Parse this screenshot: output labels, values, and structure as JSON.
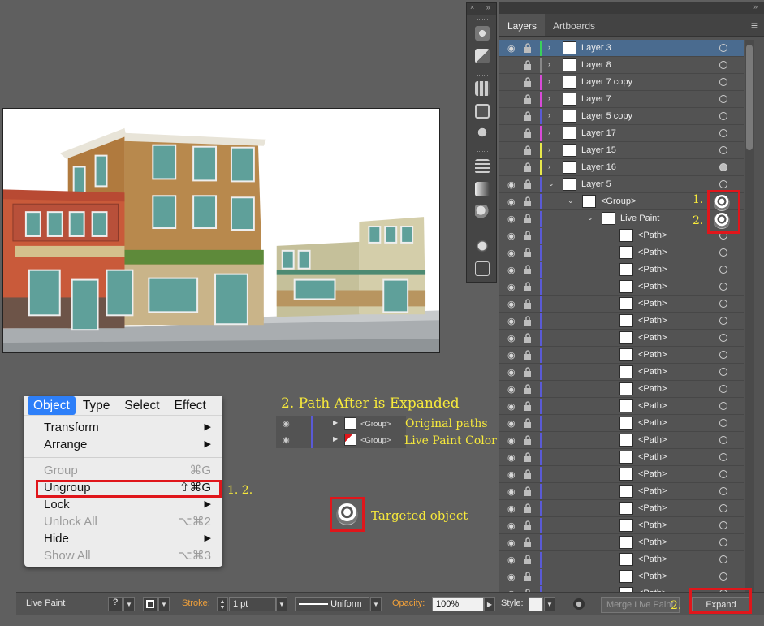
{
  "menu": {
    "bar": [
      "Object",
      "Type",
      "Select",
      "Effect"
    ],
    "items": [
      {
        "label": "Transform",
        "shortcut": "",
        "submenu": true,
        "disabled": false
      },
      {
        "label": "Arrange",
        "shortcut": "",
        "submenu": true,
        "disabled": false
      },
      {
        "label": "Group",
        "shortcut": "⌘G",
        "submenu": false,
        "disabled": true
      },
      {
        "label": "Ungroup",
        "shortcut": "⇧⌘G",
        "submenu": false,
        "disabled": false
      },
      {
        "label": "Lock",
        "shortcut": "",
        "submenu": true,
        "disabled": false
      },
      {
        "label": "Unlock All",
        "shortcut": "⌥⌘2",
        "submenu": false,
        "disabled": true
      },
      {
        "label": "Hide",
        "shortcut": "",
        "submenu": true,
        "disabled": false
      },
      {
        "label": "Show All",
        "shortcut": "⌥⌘3",
        "submenu": false,
        "disabled": true
      }
    ],
    "submenu_arrow": "▶"
  },
  "annotations": {
    "ungroup_steps": "1. 2.",
    "expanded_title": "2. Path After is Expanded",
    "original_paths": "Original paths",
    "live_paint_color": "Live Paint Color",
    "targeted_object": "Targeted object",
    "step1": "1.",
    "step2": "2.",
    "step2_expand": "2."
  },
  "expanded_rows": [
    {
      "label": "<Group>"
    },
    {
      "label": "<Group>"
    }
  ],
  "panel": {
    "top_close": "×",
    "top_collapse": "»",
    "tabs": [
      "Layers",
      "Artboards"
    ],
    "menu_icon": "≡",
    "rows": [
      {
        "label": "Layer 3",
        "color": "#3ad15a",
        "depth": 0,
        "eye": true,
        "tri": ">",
        "sel": true,
        "filled": false
      },
      {
        "label": "Layer 8",
        "color": "#888888",
        "depth": 0,
        "eye": false,
        "tri": ">",
        "sel": false,
        "filled": false
      },
      {
        "label": "Layer 7 copy",
        "color": "#d84ad8",
        "depth": 0,
        "eye": false,
        "tri": ">",
        "sel": false,
        "filled": false
      },
      {
        "label": "Layer 7",
        "color": "#d84ad8",
        "depth": 0,
        "eye": false,
        "tri": ">",
        "sel": false,
        "filled": false
      },
      {
        "label": "Layer 5 copy",
        "color": "#5a5ad6",
        "depth": 0,
        "eye": false,
        "tri": ">",
        "sel": false,
        "filled": false
      },
      {
        "label": "Layer 17",
        "color": "#d84ad8",
        "depth": 0,
        "eye": false,
        "tri": ">",
        "sel": false,
        "filled": false
      },
      {
        "label": "Layer 15",
        "color": "#e8e84a",
        "depth": 0,
        "eye": false,
        "tri": ">",
        "sel": false,
        "filled": false
      },
      {
        "label": "Layer 16",
        "color": "#e8e84a",
        "depth": 0,
        "eye": false,
        "tri": ">",
        "sel": false,
        "filled": true
      },
      {
        "label": "Layer 5",
        "color": "#5a5ad6",
        "depth": 0,
        "eye": true,
        "tri": "v",
        "sel": false,
        "filled": false
      },
      {
        "label": "<Group>",
        "color": "#5a5ad6",
        "depth": 1,
        "eye": true,
        "tri": "v",
        "sel": false,
        "filled": false
      },
      {
        "label": "Live Paint",
        "color": "#5a5ad6",
        "depth": 2,
        "eye": true,
        "tri": "v",
        "sel": false,
        "filled": false
      },
      {
        "label": "<Path>",
        "color": "#5a5ad6",
        "depth": 3,
        "eye": true,
        "tri": "",
        "sel": false,
        "filled": false
      },
      {
        "label": "<Path>",
        "color": "#5a5ad6",
        "depth": 3,
        "eye": true,
        "tri": "",
        "sel": false,
        "filled": false
      },
      {
        "label": "<Path>",
        "color": "#5a5ad6",
        "depth": 3,
        "eye": true,
        "tri": "",
        "sel": false,
        "filled": false
      },
      {
        "label": "<Path>",
        "color": "#5a5ad6",
        "depth": 3,
        "eye": true,
        "tri": "",
        "sel": false,
        "filled": false
      },
      {
        "label": "<Path>",
        "color": "#5a5ad6",
        "depth": 3,
        "eye": true,
        "tri": "",
        "sel": false,
        "filled": false
      },
      {
        "label": "<Path>",
        "color": "#5a5ad6",
        "depth": 3,
        "eye": true,
        "tri": "",
        "sel": false,
        "filled": false
      },
      {
        "label": "<Path>",
        "color": "#5a5ad6",
        "depth": 3,
        "eye": true,
        "tri": "",
        "sel": false,
        "filled": false
      },
      {
        "label": "<Path>",
        "color": "#5a5ad6",
        "depth": 3,
        "eye": true,
        "tri": "",
        "sel": false,
        "filled": false
      },
      {
        "label": "<Path>",
        "color": "#5a5ad6",
        "depth": 3,
        "eye": true,
        "tri": "",
        "sel": false,
        "filled": false
      },
      {
        "label": "<Path>",
        "color": "#5a5ad6",
        "depth": 3,
        "eye": true,
        "tri": "",
        "sel": false,
        "filled": false
      },
      {
        "label": "<Path>",
        "color": "#5a5ad6",
        "depth": 3,
        "eye": true,
        "tri": "",
        "sel": false,
        "filled": false
      },
      {
        "label": "<Path>",
        "color": "#5a5ad6",
        "depth": 3,
        "eye": true,
        "tri": "",
        "sel": false,
        "filled": false
      },
      {
        "label": "<Path>",
        "color": "#5a5ad6",
        "depth": 3,
        "eye": true,
        "tri": "",
        "sel": false,
        "filled": false
      },
      {
        "label": "<Path>",
        "color": "#5a5ad6",
        "depth": 3,
        "eye": true,
        "tri": "",
        "sel": false,
        "filled": false
      },
      {
        "label": "<Path>",
        "color": "#5a5ad6",
        "depth": 3,
        "eye": true,
        "tri": "",
        "sel": false,
        "filled": false
      },
      {
        "label": "<Path>",
        "color": "#5a5ad6",
        "depth": 3,
        "eye": true,
        "tri": "",
        "sel": false,
        "filled": false
      },
      {
        "label": "<Path>",
        "color": "#5a5ad6",
        "depth": 3,
        "eye": true,
        "tri": "",
        "sel": false,
        "filled": false
      },
      {
        "label": "<Path>",
        "color": "#5a5ad6",
        "depth": 3,
        "eye": true,
        "tri": "",
        "sel": false,
        "filled": false
      },
      {
        "label": "<Path>",
        "color": "#5a5ad6",
        "depth": 3,
        "eye": true,
        "tri": "",
        "sel": false,
        "filled": false
      },
      {
        "label": "<Path>",
        "color": "#5a5ad6",
        "depth": 3,
        "eye": true,
        "tri": "",
        "sel": false,
        "filled": false
      },
      {
        "label": "<Path>",
        "color": "#5a5ad6",
        "depth": 3,
        "eye": true,
        "tri": "",
        "sel": false,
        "filled": false
      },
      {
        "label": "<Path>",
        "color": "#5a5ad6",
        "depth": 3,
        "eye": true,
        "tri": "",
        "sel": false,
        "filled": false
      }
    ]
  },
  "control_bar": {
    "object_type": "Live Paint",
    "stroke_label": "Stroke:",
    "stroke_value": "1 pt",
    "profile": "Uniform",
    "opacity_label": "Opacity:",
    "opacity_value": "100%",
    "style_label": "Style:",
    "merge_label": "Merge Live Paint",
    "expand_label": "Expand"
  }
}
